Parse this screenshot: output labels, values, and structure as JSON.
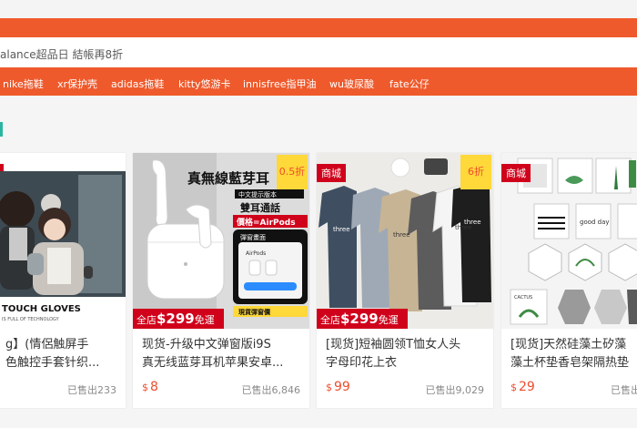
{
  "colors": {
    "brand": "#ef5a2c",
    "price": "#ee4d2d",
    "mall_badge": "#d0011b",
    "discount_badge": "#ffd839",
    "section_accent": "#2bb5a0"
  },
  "search": {
    "placeholder": "alance超品日 結帳再8折"
  },
  "hot_keywords": [
    "nike拖鞋",
    "xr保护壳",
    "adidas拖鞋",
    "kitty悠游卡",
    "innisfree指甲油",
    "wu玻尿酸",
    "fate公仔"
  ],
  "products": [
    {
      "title": "g】(情侶触屏手\n色触控手套针织...",
      "price_symbol": "$",
      "price": "",
      "sold": "已售出233",
      "badge": "",
      "discount": "",
      "image_text": "TOUCH GLOVES",
      "image_subtext": "IS FULL OF TECHNOLOGY"
    },
    {
      "title": "现货-升级中文弹窗版i9S\n真无线蓝芽耳机苹果安卓...",
      "price_symbol": "$",
      "price": "8",
      "sold": "已售出6,846",
      "badge": "",
      "discount": "0.5折",
      "promo_prefix": "全店",
      "promo_amount": "$299",
      "promo_suffix": "免運",
      "image_text": "真無線藍芽耳",
      "image_subtext": "中文提示版本",
      "image_line3": "雙耳通話",
      "image_line4": "價格=AirPods",
      "image_line5": "彈窗畫面",
      "image_line6": "現貨彈窗價",
      "image_airpods": "AirPods"
    },
    {
      "title": "[现货]短袖圆领T恤女人头\n字母印花上衣",
      "price_symbol": "$",
      "price": "99",
      "sold": "已售出9,029",
      "badge": "商城",
      "discount": "6折",
      "promo_prefix": "全店",
      "promo_amount": "$299",
      "promo_suffix": "免運",
      "image_text": "three"
    },
    {
      "title": "[现货]天然硅藻土矽藻\n藻土杯垫香皂架隔热垫",
      "price_symbol": "$",
      "price": "29",
      "sold": "已售出",
      "badge": "商城",
      "discount": "",
      "image_text": "good day",
      "image_subtext": "CACTUS"
    }
  ]
}
